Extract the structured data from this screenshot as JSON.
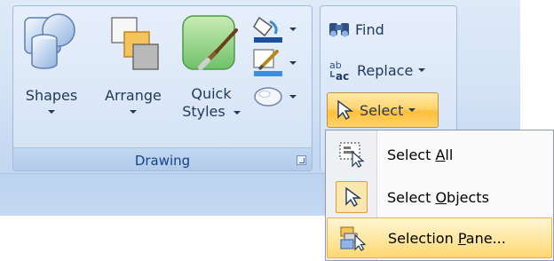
{
  "ribbon": {
    "drawing_group": {
      "label": "Drawing",
      "buttons": {
        "shapes": "Shapes",
        "arrange": "Arrange",
        "quick_styles_line1": "Quick",
        "quick_styles_line2": "Styles"
      },
      "small_buttons": [
        "shape-fill-icon",
        "shape-outline-icon",
        "shape-effects-icon"
      ]
    },
    "editing_group": {
      "find": "Find",
      "replace": "Replace",
      "select": "Select"
    }
  },
  "select_menu": {
    "items": [
      {
        "before": "Select ",
        "accel": "A",
        "after": "ll",
        "icon": "select-all-icon"
      },
      {
        "before": "Select ",
        "accel": "O",
        "after": "bjects",
        "icon": "select-objects-icon",
        "checked": true
      },
      {
        "before": "Selection ",
        "accel": "P",
        "after": "ane...",
        "icon": "selection-pane-icon",
        "highlighted": true
      }
    ]
  },
  "colors": {
    "ribbon_text": "#1e395b",
    "group_label": "#15428b",
    "highlight": "#ffd46e"
  }
}
